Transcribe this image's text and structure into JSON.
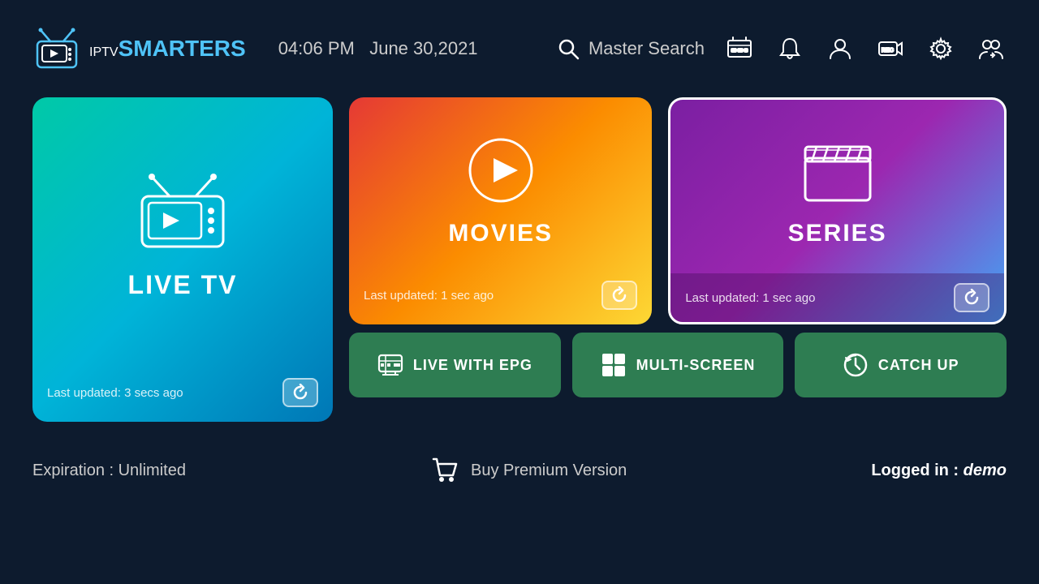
{
  "header": {
    "logo_iptv": "IPTV",
    "logo_smarters": "SMARTERS",
    "time": "04:06 PM",
    "date": "June 30,2021",
    "search_label": "Master Search"
  },
  "cards": {
    "live_tv": {
      "title": "LIVE TV",
      "update": "Last updated: 3 secs ago"
    },
    "movies": {
      "title": "MOVIES",
      "update": "Last updated: 1 sec ago"
    },
    "series": {
      "title": "SERIES",
      "update": "Last updated: 1 sec ago"
    }
  },
  "buttons": {
    "live_epg": "LIVE WITH EPG",
    "multi_screen": "MULTI-SCREEN",
    "catch_up": "CATCH UP"
  },
  "footer": {
    "expiration": "Expiration : Unlimited",
    "buy_premium": "Buy Premium Version",
    "logged_in_label": "Logged in :",
    "logged_in_user": "demo"
  }
}
